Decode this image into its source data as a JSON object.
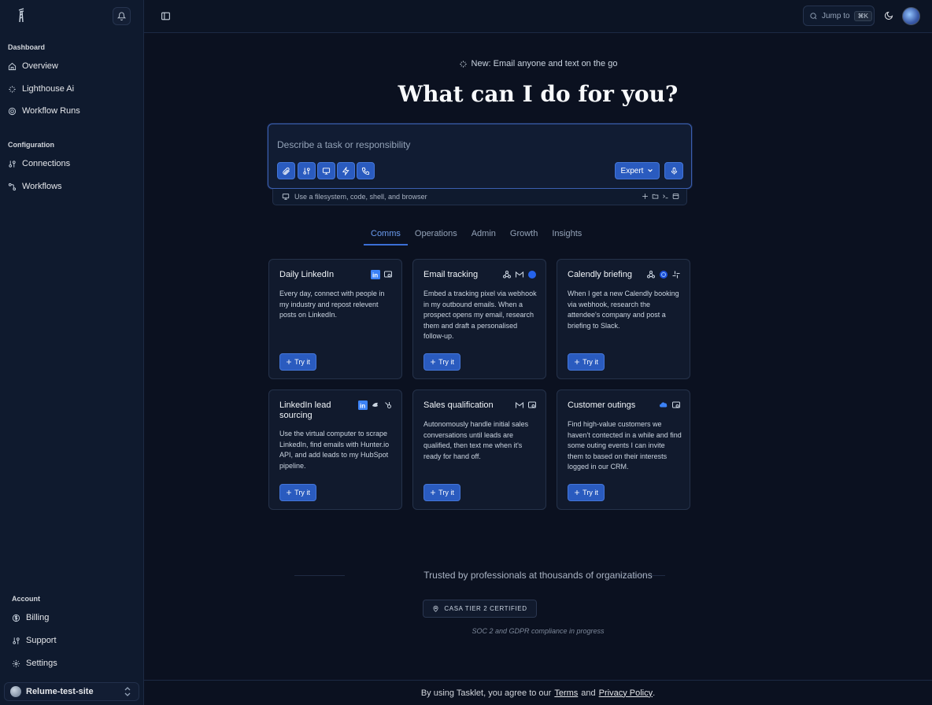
{
  "sidebar": {
    "sections": [
      {
        "label": "Dashboard"
      },
      {
        "label": "Configuration"
      },
      {
        "label": "Account"
      }
    ],
    "dashboard_items": [
      {
        "label": "Overview",
        "icon": "home-icon"
      },
      {
        "label": "Lighthouse Ai",
        "icon": "sparkles-icon"
      },
      {
        "label": "Workflow Runs",
        "icon": "target-icon"
      }
    ],
    "configuration_items": [
      {
        "label": "Connections",
        "icon": "connections-icon"
      },
      {
        "label": "Workflows",
        "icon": "workflow-icon"
      }
    ],
    "account_items": [
      {
        "label": "Billing",
        "icon": "dollar-icon"
      },
      {
        "label": "Support",
        "icon": "support-icon"
      },
      {
        "label": "Settings",
        "icon": "gear-icon"
      }
    ],
    "workspace_name": "Relume-test-site"
  },
  "topbar": {
    "jump_label": "Jump to",
    "jump_shortcut": "⌘K"
  },
  "main": {
    "announcement": "New: Email anyone and text on the go",
    "hero_title": "What can I do for you?",
    "composer": {
      "placeholder": "Describe a task or responsibility",
      "mode_label": "Expert"
    },
    "capability_text": "Use a filesystem, code, shell, and browser",
    "tabs": [
      "Comms",
      "Operations",
      "Admin",
      "Growth",
      "Insights"
    ],
    "active_tab": "Comms",
    "cards": [
      {
        "title": "Daily LinkedIn",
        "description": "Every day, connect with people in my industry and repost relevent posts on LinkedIn.",
        "button": "Try it"
      },
      {
        "title": "Email tracking",
        "description": "Embed a tracking pixel via webhook in my outbound emails. When a prospect opens my email, research them and draft a personalised follow-up.",
        "button": "Try it"
      },
      {
        "title": "Calendly briefing",
        "description": "When I get a new Calendly booking via webhook, research the attendee's company and post a briefing to Slack.",
        "button": "Try it"
      },
      {
        "title": "LinkedIn lead sourcing",
        "description": "Use the virtual computer to scrape LinkedIn, find emails with Hunter.io API, and add leads to my HubSpot pipeline.",
        "button": "Try it"
      },
      {
        "title": "Sales qualification",
        "description": "Autonomously handle initial sales conversations until leads are qualified, then text me when it's ready for hand off.",
        "button": "Try it"
      },
      {
        "title": "Customer outings",
        "description": "Find high-value customers we haven't contected in a while and find some outing events I can invite them to based on their interests logged in our CRM.",
        "button": "Try it"
      }
    ],
    "trusted_text": "Trusted by professionals at thousands of organizations",
    "certification": "CASA TIER 2 CERTIFIED",
    "compliance": "SOC 2 and GDPR compliance in progress"
  },
  "footer": {
    "prefix": "By using Tasklet, you agree to our",
    "terms": "Terms",
    "and": "and",
    "privacy": "Privacy Policy",
    "suffix": "."
  },
  "colors": {
    "background": "#0b1120",
    "sidebar": "#0f1a2e",
    "accent": "#2a5bbf",
    "active_tab": "#6b9cf0"
  }
}
